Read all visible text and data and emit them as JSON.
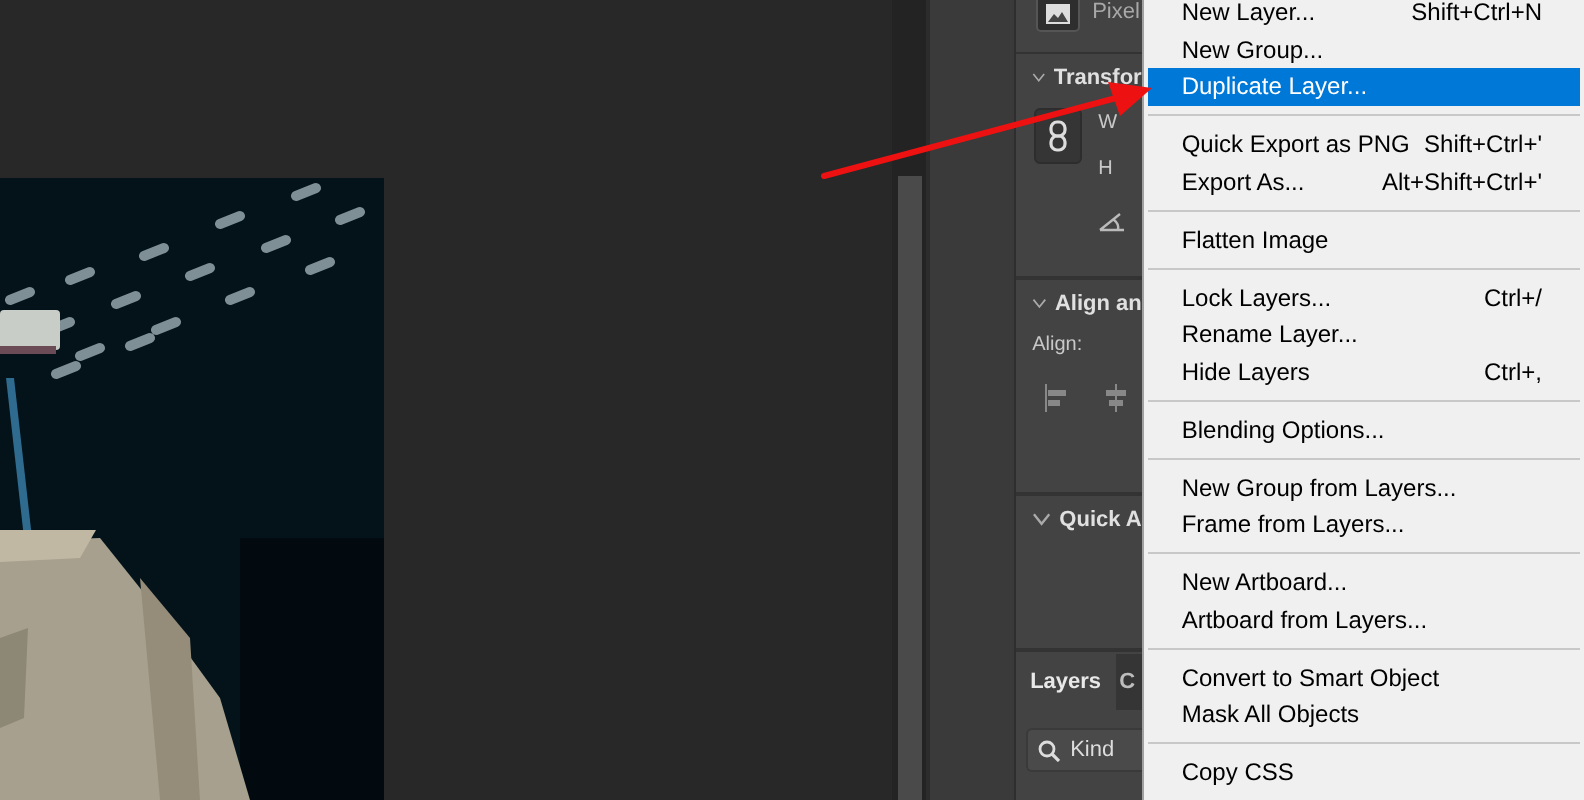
{
  "properties": {
    "layer_type": "Pixel",
    "sections": [
      {
        "kind": "transform",
        "title": "Transfor",
        "expanded": true,
        "labels": [
          "W",
          "H"
        ]
      },
      {
        "kind": "align",
        "title": "Align an",
        "expanded": true,
        "label": "Align:"
      },
      {
        "kind": "quick",
        "title": "Quick A",
        "expanded": true
      }
    ]
  },
  "layers_panel": {
    "tabs": [
      {
        "label": "Layers",
        "selected": true
      },
      {
        "label": "C",
        "selected": false
      }
    ],
    "search": {
      "placeholder": "Kind"
    }
  },
  "menu": {
    "items": [
      {
        "kind": "item",
        "label": "New Layer...",
        "shortcut": "Shift+Ctrl+N",
        "selected": false
      },
      {
        "kind": "item",
        "label": "New Group...",
        "selected": false
      },
      {
        "kind": "item",
        "label": "Duplicate Layer...",
        "selected": true
      },
      {
        "kind": "separator"
      },
      {
        "kind": "item",
        "label": "Quick Export as PNG",
        "shortcut": "Shift+Ctrl+'",
        "selected": false
      },
      {
        "kind": "item",
        "label": "Export As...",
        "shortcut": "Alt+Shift+Ctrl+'",
        "selected": false
      },
      {
        "kind": "separator"
      },
      {
        "kind": "item",
        "label": "Flatten Image",
        "selected": false
      },
      {
        "kind": "separator"
      },
      {
        "kind": "item",
        "label": "Lock Layers...",
        "shortcut": "Ctrl+/",
        "selected": false
      },
      {
        "kind": "item",
        "label": "Rename Layer...",
        "selected": false
      },
      {
        "kind": "item",
        "label": "Hide Layers",
        "shortcut": "Ctrl+,",
        "selected": false
      },
      {
        "kind": "separator"
      },
      {
        "kind": "item",
        "label": "Blending Options...",
        "selected": false
      },
      {
        "kind": "separator"
      },
      {
        "kind": "item",
        "label": "New Group from Layers...",
        "selected": false
      },
      {
        "kind": "item",
        "label": "Frame from Layers...",
        "selected": false
      },
      {
        "kind": "separator"
      },
      {
        "kind": "item",
        "label": "New Artboard...",
        "selected": false
      },
      {
        "kind": "item",
        "label": "Artboard from Layers...",
        "selected": false
      },
      {
        "kind": "separator"
      },
      {
        "kind": "item",
        "label": "Convert to Smart Object",
        "selected": false
      },
      {
        "kind": "item",
        "label": "Mask All Objects",
        "selected": false
      },
      {
        "kind": "separator"
      },
      {
        "kind": "item",
        "label": "Copy CSS",
        "selected": false
      }
    ]
  }
}
